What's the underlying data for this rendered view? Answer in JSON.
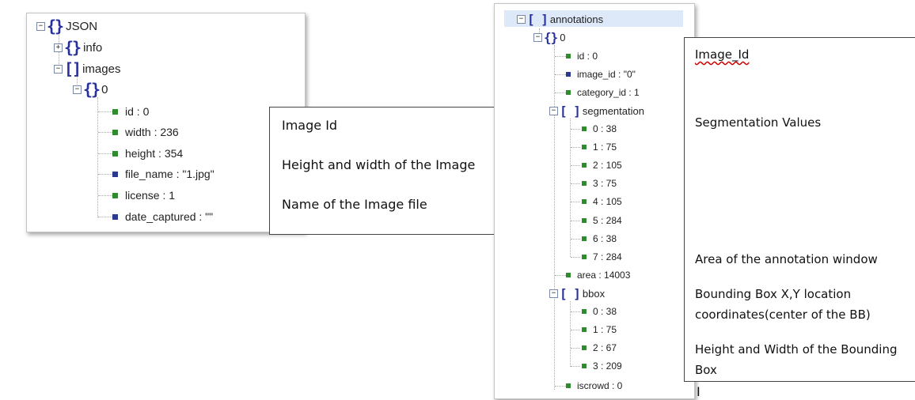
{
  "left_tree": {
    "root_label": "JSON",
    "info_label": "info",
    "images_label": "images",
    "item0_label": "0",
    "fields": [
      {
        "text": "id : 0",
        "kind": "num"
      },
      {
        "text": "width : 236",
        "kind": "num"
      },
      {
        "text": "height : 354",
        "kind": "num"
      },
      {
        "text": "file_name : \"1.jpg\"",
        "kind": "str"
      },
      {
        "text": "license : 1",
        "kind": "num"
      },
      {
        "text": "date_captured : \"\"",
        "kind": "str"
      }
    ]
  },
  "left_notes": {
    "image_id": "Image Id",
    "height_width": "Height and width of the Image",
    "file_name": "Name of the Image file"
  },
  "right_tree": {
    "annotations_label": "annotations",
    "item0_label": "0",
    "id": "id : 0",
    "image_id": "image_id : \"0\"",
    "category_id": "category_id : 1",
    "segmentation_label": "segmentation",
    "segmentation": [
      "0 : 38",
      "1 : 75",
      "2 : 105",
      "3 : 75",
      "4 : 105",
      "5 : 284",
      "6 : 38",
      "7 : 284"
    ],
    "area": "area : 14003",
    "bbox_label": "bbox",
    "bbox": [
      "0 : 38",
      "1 : 75",
      "2 : 67",
      "3 : 209"
    ],
    "iscrowd": "iscrowd : 0"
  },
  "right_notes": {
    "image_id": "Image_Id",
    "segmentation": "Segmentation Values",
    "area": "Area of the annotation window",
    "bbox_xy_line1": "Bounding Box X,Y location",
    "bbox_xy_line2": "coordinates(center of the BB)",
    "bbox_hw_line1": "Height and Width of the Bounding",
    "bbox_hw_line2": "Box",
    "cursor": "I"
  },
  "colors": {
    "brace": "#27309b",
    "number_leaf": "#2e8b2e",
    "string_leaf": "#2b3a8f",
    "selection": "#dde8f8"
  }
}
